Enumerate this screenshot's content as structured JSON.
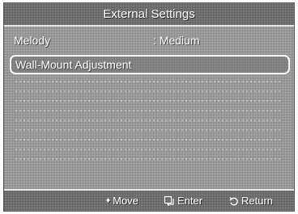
{
  "title": "External Settings",
  "menu": {
    "melody": {
      "label": "Melody",
      "value": ": Medium"
    },
    "wall_mount": {
      "label": "Wall-Mount Adjustment"
    }
  },
  "footer": {
    "move_label": "Move",
    "move_icon": "up-down-icon",
    "enter_label": "Enter",
    "enter_icon": "enter-icon",
    "return_label": "Return",
    "return_icon": "return-icon"
  },
  "colors": {
    "text": "#ffffff",
    "panel": "#9a9a9a",
    "bar": "#6e6e6e",
    "highlight_border": "#ffffff"
  }
}
